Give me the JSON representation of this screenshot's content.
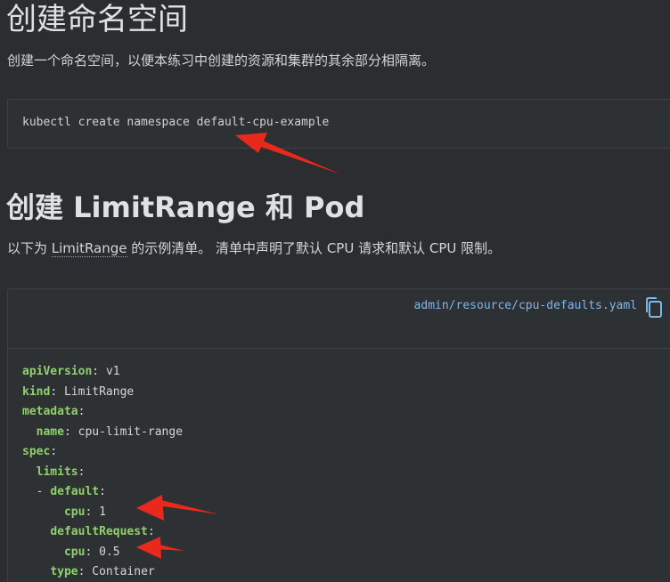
{
  "section1": {
    "title": "创建命名空间",
    "description": "创建一个命名空间，以便本练习中创建的资源和集群的其余部分相隔离。",
    "command": "kubectl create namespace default-cpu-example"
  },
  "section2": {
    "title": "创建 LimitRange 和 Pod",
    "description_prefix": "以下为 ",
    "description_link": "LimitRange",
    "description_suffix": " 的示例清单。 清单中声明了默认 CPU 请求和默认 CPU 限制。"
  },
  "manifest": {
    "file_link": "admin/resource/cpu-defaults.yaml",
    "copy_icon": "copy-icon",
    "lines": [
      {
        "indent": "",
        "key": "apiVersion",
        "sep": ": ",
        "value": "v1"
      },
      {
        "indent": "",
        "key": "kind",
        "sep": ": ",
        "value": "LimitRange"
      },
      {
        "indent": "",
        "key": "metadata",
        "sep": ":",
        "value": ""
      },
      {
        "indent": "  ",
        "key": "name",
        "sep": ": ",
        "value": "cpu-limit-range"
      },
      {
        "indent": "",
        "key": "spec",
        "sep": ":",
        "value": ""
      },
      {
        "indent": "  ",
        "key": "limits",
        "sep": ":",
        "value": ""
      },
      {
        "indent": "  - ",
        "key": "default",
        "sep": ":",
        "value": ""
      },
      {
        "indent": "      ",
        "key": "cpu",
        "sep": ": ",
        "value": "1"
      },
      {
        "indent": "    ",
        "key": "defaultRequest",
        "sep": ":",
        "value": ""
      },
      {
        "indent": "      ",
        "key": "cpu",
        "sep": ": ",
        "value": "0.5"
      },
      {
        "indent": "    ",
        "key": "type",
        "sep": ": ",
        "value": "Container"
      }
    ]
  },
  "annotations": {
    "arrow_color": "#e8291c"
  }
}
